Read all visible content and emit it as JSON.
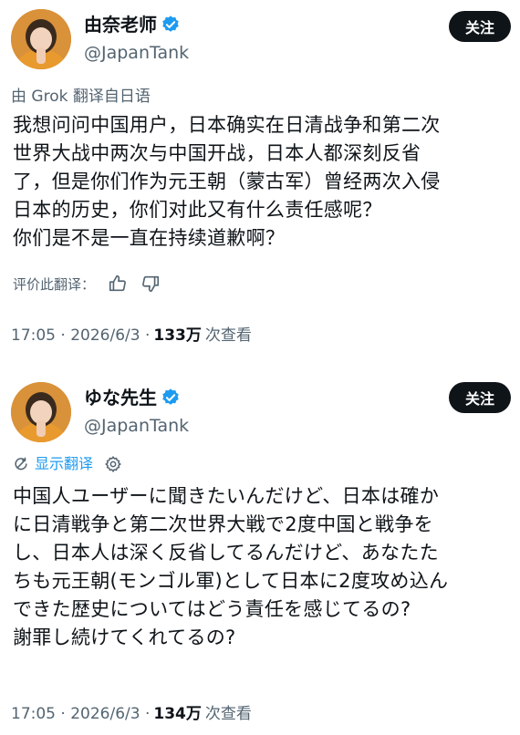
{
  "posts": [
    {
      "display_name": "由奈老师",
      "handle": "@JapanTank",
      "follow_label": "关注",
      "translated_by": "由 Grok 翻译自日语",
      "body": "我想问问中国用户，日本确实在日清战争和第二次\n世界大战中两次与中国开战，日本人都深刻反省\n了，但是你们作为元王朝（蒙古军）曾经两次入侵\n日本的历史，你们对此又有什么责任感呢？\n你们是不是一直在持续道歉啊？",
      "rate_label": "评价此翻译：",
      "timestamp": "17:05 · 2026/6/3 ·",
      "views_count": "133万",
      "views_label": "次查看"
    },
    {
      "display_name": "ゆな先生",
      "handle": "@JapanTank",
      "follow_label": "关注",
      "show_translation_label": "显示翻译",
      "body": "中国人ユーザーに聞きたいんだけど、日本は確か\nに日清戦争と第二次世界大戦で2度中国と戦争を\nし、日本人は深く反省してるんだけど、あなたた\nちも元王朝(モンゴル軍)として日本に2度攻め込ん\nできた歴史についてはどう責任を感じてるの?\n謝罪し続けてくれてるの?",
      "timestamp": "17:05 · 2026/6/3 ·",
      "views_count": "134万",
      "views_label": "次查看"
    }
  ],
  "colors": {
    "text": "#0f1419",
    "secondary": "#536471",
    "accent": "#1d9bf0",
    "follow_bg": "#0f1419"
  },
  "icons": {
    "verified": "verified-badge-icon",
    "thumbs_up": "thumbs-up-icon",
    "thumbs_down": "thumbs-down-icon",
    "translate": "translate-icon",
    "gear": "gear-icon"
  }
}
